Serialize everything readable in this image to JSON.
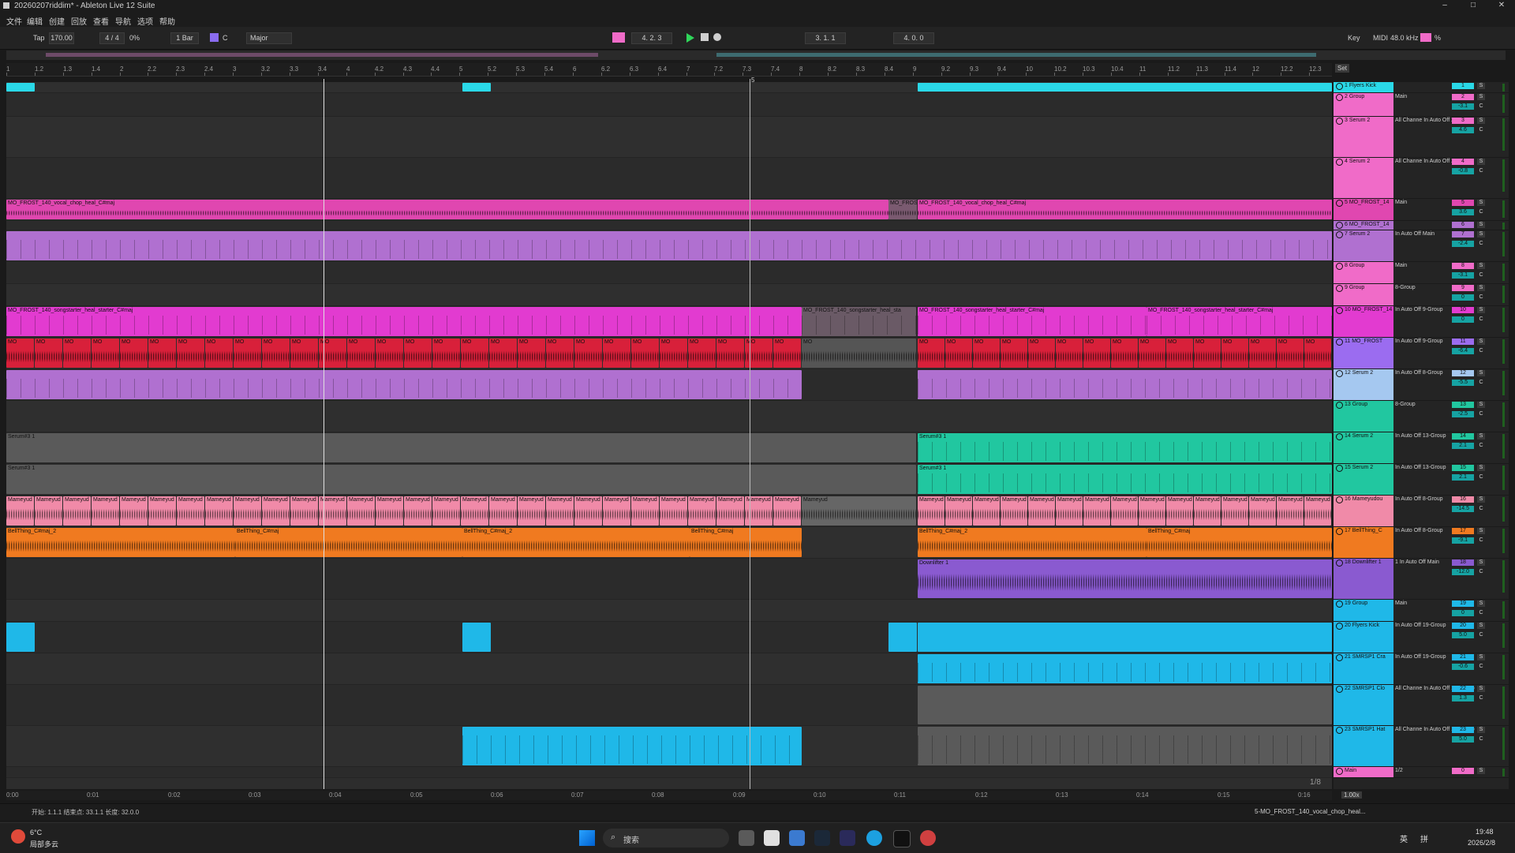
{
  "window": {
    "title": "20260207riddim* - Ableton Live 12 Suite",
    "controls": [
      "–",
      "□",
      "✕"
    ]
  },
  "menu": [
    "文件",
    "编辑",
    "创建",
    "回放",
    "查看",
    "导航",
    "选项",
    "帮助"
  ],
  "transport": {
    "tap": "Tap",
    "tempo": "170.00",
    "time_signature": "4 / 4",
    "groove": "0%",
    "quantize": "1 Bar",
    "key": "C",
    "scale": "Major",
    "position": "4.  2.  3",
    "loop_start": "3.  1.  1",
    "loop_length": "4.  0.  0",
    "key_label": "Key",
    "midi_label": "MIDI",
    "sample_rate": "48.0 kHz",
    "cpu": "%",
    "set_label": "Set"
  },
  "ruler": {
    "bars": [
      "1",
      "1.2",
      "1.3",
      "1.4",
      "2",
      "2.2",
      "2.3",
      "2.4",
      "3",
      "3.2",
      "3.3",
      "3.4",
      "4",
      "4.2",
      "4.3",
      "4.4",
      "5",
      "5.2",
      "5.3",
      "5.4",
      "6",
      "6.2",
      "6.3",
      "6.4",
      "7",
      "7.2",
      "7.3",
      "7.4",
      "8",
      "8.2",
      "8.3",
      "8.4",
      "9",
      "9.2",
      "9.3",
      "9.4",
      "10",
      "10.2",
      "10.3",
      "10.4",
      "11",
      "11.2",
      "11.3",
      "11.4",
      "12",
      "12.2",
      "12.3"
    ],
    "marker": "5"
  },
  "time_ruler": [
    "0:00",
    "0:01",
    "0:02",
    "0:03",
    "0:04",
    "0:05",
    "0:06",
    "0:07",
    "0:08",
    "0:09",
    "0:10",
    "0:11",
    "0:12",
    "0:13",
    "0:14",
    "0:15",
    "0:16"
  ],
  "zoom": "1/8",
  "clips": {
    "vocal_chop": "MO_FROST_140_vocal_chop_heal_C#maj",
    "vocal_chop_short": "MO_FROS",
    "songstarter": "MO_FROST_140_songstarter_heal_starter_C#maj",
    "songstarter_cut": "MO_FROST_140_songstarter_heal_sta",
    "serum_a": "Serum#3 1",
    "serum_b": "Serum#3 1",
    "mameyudou": "Mameyud",
    "bellthing": "BellThing_C#maj_2",
    "bellthing_b": "BellThing_C#maj",
    "downlifter": "Downlifter 1",
    "mo": "MO"
  },
  "tracks": [
    {
      "name": "1 Flyers Kick",
      "num": "1",
      "vol": "",
      "color": "#2ad9e8",
      "io": ""
    },
    {
      "name": "2 Group",
      "num": "2",
      "vol": "-3.1",
      "color": "#f06bc8",
      "io": "Main"
    },
    {
      "name": "3 Serum 2",
      "num": "3",
      "vol": "4.6",
      "color": "#f06bc8",
      "io": "All Channe  In Auto Off  2-Group"
    },
    {
      "name": "4 Serum 2",
      "num": "4",
      "vol": "-0.8",
      "color": "#f06bc8",
      "io": "All Channe  In Auto Off  2-Group"
    },
    {
      "name": "5 MO_FROST_14",
      "num": "5",
      "vol": "3.6",
      "color": "#e047b0",
      "io": "Main"
    },
    {
      "name": "6 MO_FROST_14",
      "num": "6",
      "vol": "",
      "color": "#b070d0",
      "io": ""
    },
    {
      "name": "7 Serum 2",
      "num": "7",
      "vol": "-2.4",
      "color": "#b070d0",
      "io": "In Auto Off  Main"
    },
    {
      "name": "8 Group",
      "num": "8",
      "vol": "-3.1",
      "color": "#f06bc8",
      "io": "Main"
    },
    {
      "name": "9 Group",
      "num": "9",
      "vol": "0",
      "color": "#f06bc8",
      "io": "8-Group"
    },
    {
      "name": "10 MO_FROST_14",
      "num": "10",
      "vol": "0",
      "color": "#e23bd0",
      "io": "In Auto Off  9-Group"
    },
    {
      "name": "11 MO_FROST",
      "num": "11",
      "vol": "-6.4",
      "color": "#9b6cf0",
      "io": "In Auto Off  9-Group"
    },
    {
      "name": "12 Serum 2",
      "num": "12",
      "vol": "-5.5",
      "color": "#a5c8f0",
      "io": "In Auto Off  8-Group"
    },
    {
      "name": "13 Group",
      "num": "13",
      "vol": "-2.5",
      "color": "#21c7a0",
      "io": "8-Group"
    },
    {
      "name": "14 Serum 2",
      "num": "14",
      "vol": "2.1",
      "color": "#21c7a0",
      "io": "In Auto Off  13-Group"
    },
    {
      "name": "15 Serum 2",
      "num": "15",
      "vol": "2.1",
      "color": "#21c7a0",
      "io": "In Auto Off  13-Group"
    },
    {
      "name": "16 Mameyudou",
      "num": "16",
      "vol": "-14.5",
      "color": "#f08aa8",
      "io": "In Auto Off  8-Group"
    },
    {
      "name": "17 BellThing_C",
      "num": "17",
      "vol": "-9.1",
      "color": "#f07a20",
      "io": "In Auto Off  8-Group"
    },
    {
      "name": "18 Downlifter 1",
      "num": "18",
      "vol": "-12.0",
      "color": "#8a5ad0",
      "io": "1  In Auto Off  Main"
    },
    {
      "name": "19 Group",
      "num": "19",
      "vol": "0",
      "color": "#1fb8e8",
      "io": "Main"
    },
    {
      "name": "20 Flyers Kick",
      "num": "20",
      "vol": "5.0",
      "color": "#1fb8e8",
      "io": "In Auto Off  19-Group"
    },
    {
      "name": "21 SMRSP1 Cra",
      "num": "21",
      "vol": "-0.6",
      "color": "#1fb8e8",
      "io": "In Auto Off  19-Group"
    },
    {
      "name": "22 SMRSP1 Clo",
      "num": "22",
      "vol": "1.3",
      "color": "#1fb8e8",
      "io": "All Channe  In Auto Off  19-Group"
    },
    {
      "name": "23 SMRSP1 Hat",
      "num": "23",
      "vol": "5.0",
      "color": "#1fb8e8",
      "io": "All Channe  In Auto Off  19-Group"
    },
    {
      "name": "Main",
      "num": "0",
      "vol": "-6.0",
      "color": "#f06bc8",
      "io": "1/2"
    }
  ],
  "status": {
    "info": "开始: 1.1.1  结束点: 33.1.1  长度: 32.0.0",
    "selected_clip": "5-MO_FROST_140_vocal_chop_heal...",
    "zoom_value": "1.00x"
  },
  "taskbar": {
    "weather_temp": "6°C",
    "weather_desc": "局部多云",
    "search": "搜索",
    "ime": "英",
    "ime2": "拼",
    "time": "19:48",
    "date": "2026/2/8"
  }
}
